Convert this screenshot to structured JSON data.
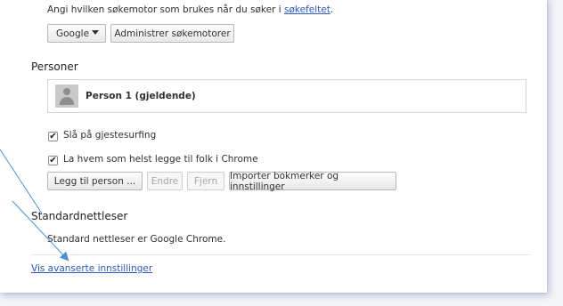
{
  "search": {
    "description": "Angi hvilken søkemotor som brukes når du søker i",
    "link": "søkefeltet",
    "period": ".",
    "engine_selected": "Google",
    "manage_button": "Administrer søkemotorer"
  },
  "people": {
    "heading": "Personer",
    "profile_name": "Person 1 (gjeldende)",
    "checkbox_guest": {
      "label": "Slå på gjestesurfing",
      "checked": true
    },
    "checkbox_anyone": {
      "label": "La hvem som helst legge til folk i Chrome",
      "checked": true
    },
    "buttons": {
      "add": "Legg til person ...",
      "edit": "Endre",
      "remove": "Fjern",
      "import": "Importer bokmerker og innstillinger"
    }
  },
  "default_browser": {
    "heading": "Standardnettleser",
    "status": "Standard nettleser er Google Chrome."
  },
  "advanced_link": "Vis avanserte innstillinger",
  "colors": {
    "link": "#2a58c7",
    "arrow": "#4a8fd8"
  },
  "icons": {
    "dropdown": "caret-down-icon",
    "checkmark": "check-icon",
    "avatar": "person-icon"
  }
}
